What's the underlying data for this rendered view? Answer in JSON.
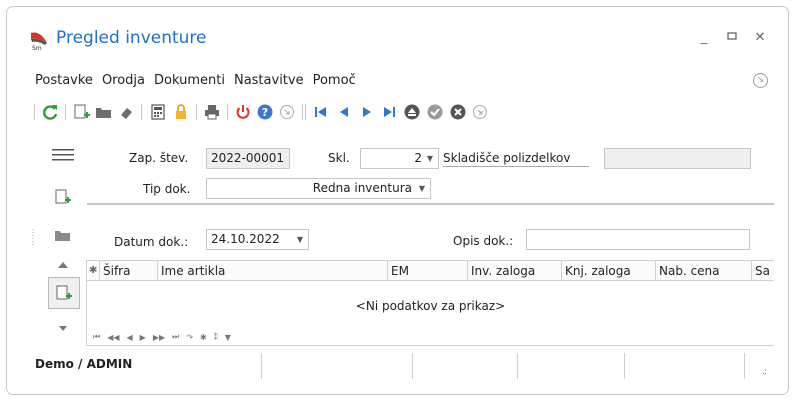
{
  "window": {
    "title": "Pregled inventure"
  },
  "menu": [
    "Postavke",
    "Orodja",
    "Dokumenti",
    "Nastavitve",
    "Pomoč"
  ],
  "toolbar_icons": [
    "refresh-icon",
    "new-document-icon",
    "folder-icon",
    "eraser-icon",
    "calculator-icon",
    "lock-icon",
    "print-icon",
    "power-icon",
    "help-icon",
    "arrow-circle-icon",
    "first-record-icon",
    "previous-record-icon",
    "next-record-icon",
    "last-record-icon",
    "eject-icon",
    "check-icon",
    "cancel-icon",
    "arrow-circle-icon"
  ],
  "form": {
    "zap_label": "Zap. štev.",
    "zap_value": "2022-00001",
    "skl_label": "Skl.",
    "skl_value": "2",
    "skl_name": "Skladišče polizdelkov",
    "tip_label": "Tip dok.",
    "tip_value": "Redna inventura",
    "datum_label": "Datum dok.:",
    "datum_value": "24.10.2022",
    "opis_label": "Opis dok.:",
    "opis_value": ""
  },
  "grid": {
    "columns": [
      "Šifra",
      "Ime artikla",
      "EM",
      "Inv. zaloga",
      "Knj. zaloga",
      "Nab. cena",
      "Sa"
    ],
    "empty_text": "<Ni podatkov za prikaz>"
  },
  "status": {
    "user": "Demo / ADMIN"
  },
  "colors": {
    "accent": "#1e6fd0",
    "red": "#d9342b",
    "green": "#2e9e3a"
  }
}
